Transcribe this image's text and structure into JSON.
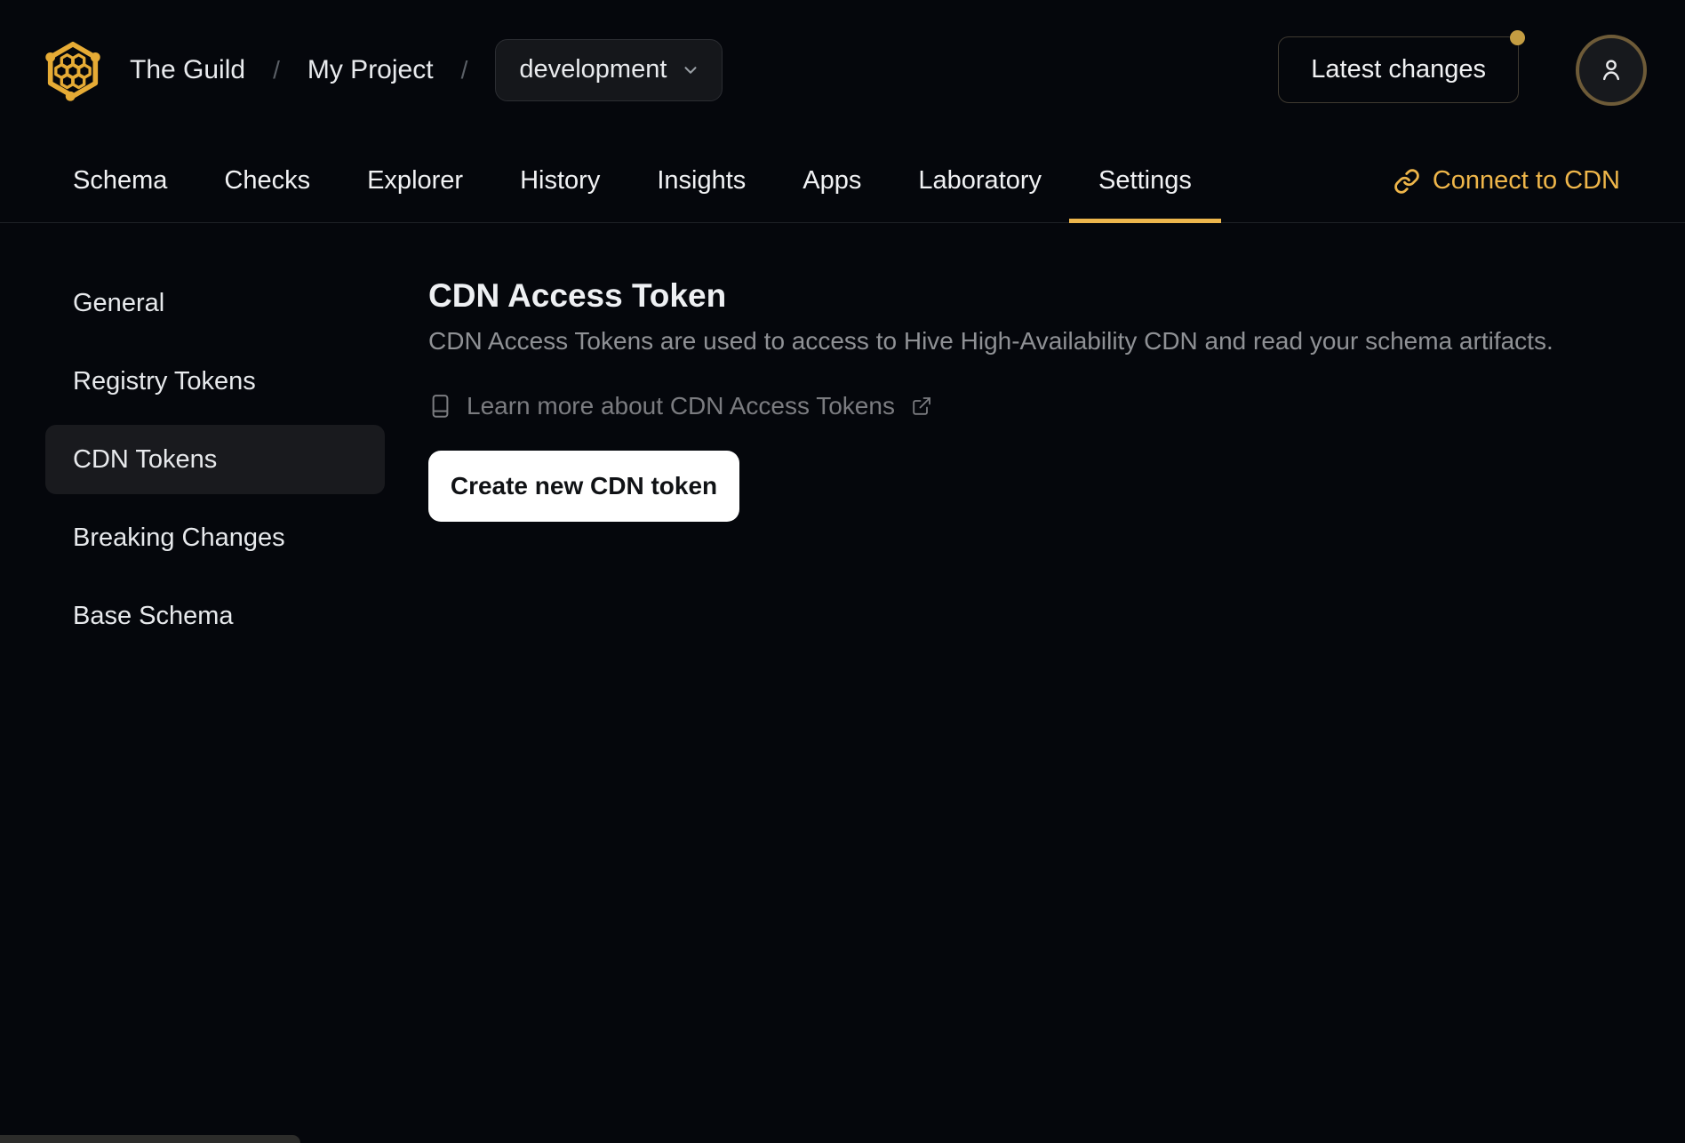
{
  "header": {
    "breadcrumb": {
      "org": "The Guild",
      "separator": "/",
      "project": "My Project"
    },
    "target_dropdown": {
      "value": "development",
      "icon": "chevron-down-icon"
    },
    "latest_changes": {
      "label": "Latest changes",
      "has_notification_dot": true
    },
    "avatar_icon": "user-icon",
    "logo_icon": "hive-honeycomb-logo"
  },
  "tabs": {
    "items": [
      {
        "label": "Schema",
        "active": false
      },
      {
        "label": "Checks",
        "active": false
      },
      {
        "label": "Explorer",
        "active": false
      },
      {
        "label": "History",
        "active": false
      },
      {
        "label": "Insights",
        "active": false
      },
      {
        "label": "Apps",
        "active": false
      },
      {
        "label": "Laboratory",
        "active": false
      },
      {
        "label": "Settings",
        "active": true
      }
    ],
    "connect_cdn": {
      "label": "Connect to CDN",
      "icon": "link-icon"
    }
  },
  "sidebar": {
    "items": [
      {
        "label": "General",
        "active": false
      },
      {
        "label": "Registry Tokens",
        "active": false
      },
      {
        "label": "CDN Tokens",
        "active": true
      },
      {
        "label": "Breaking Changes",
        "active": false
      },
      {
        "label": "Base Schema",
        "active": false
      }
    ]
  },
  "main": {
    "title": "CDN Access Token",
    "description": "CDN Access Tokens are used to access to Hive High-Availability CDN and read your schema artifacts.",
    "learn_more": {
      "label": "Learn more about CDN Access Tokens",
      "left_icon": "book-icon",
      "right_icon": "external-link-icon"
    },
    "create_button": "Create new CDN token"
  },
  "colors": {
    "background": "#05070c",
    "accent_gold": "#edb64d",
    "logo_gold": "#e6ab35",
    "notification_dot": "#c49d42",
    "active_item_bg": "#191a1e",
    "muted_text": "#8f9195",
    "button_bg": "#ffffff",
    "button_text": "#101215"
  }
}
